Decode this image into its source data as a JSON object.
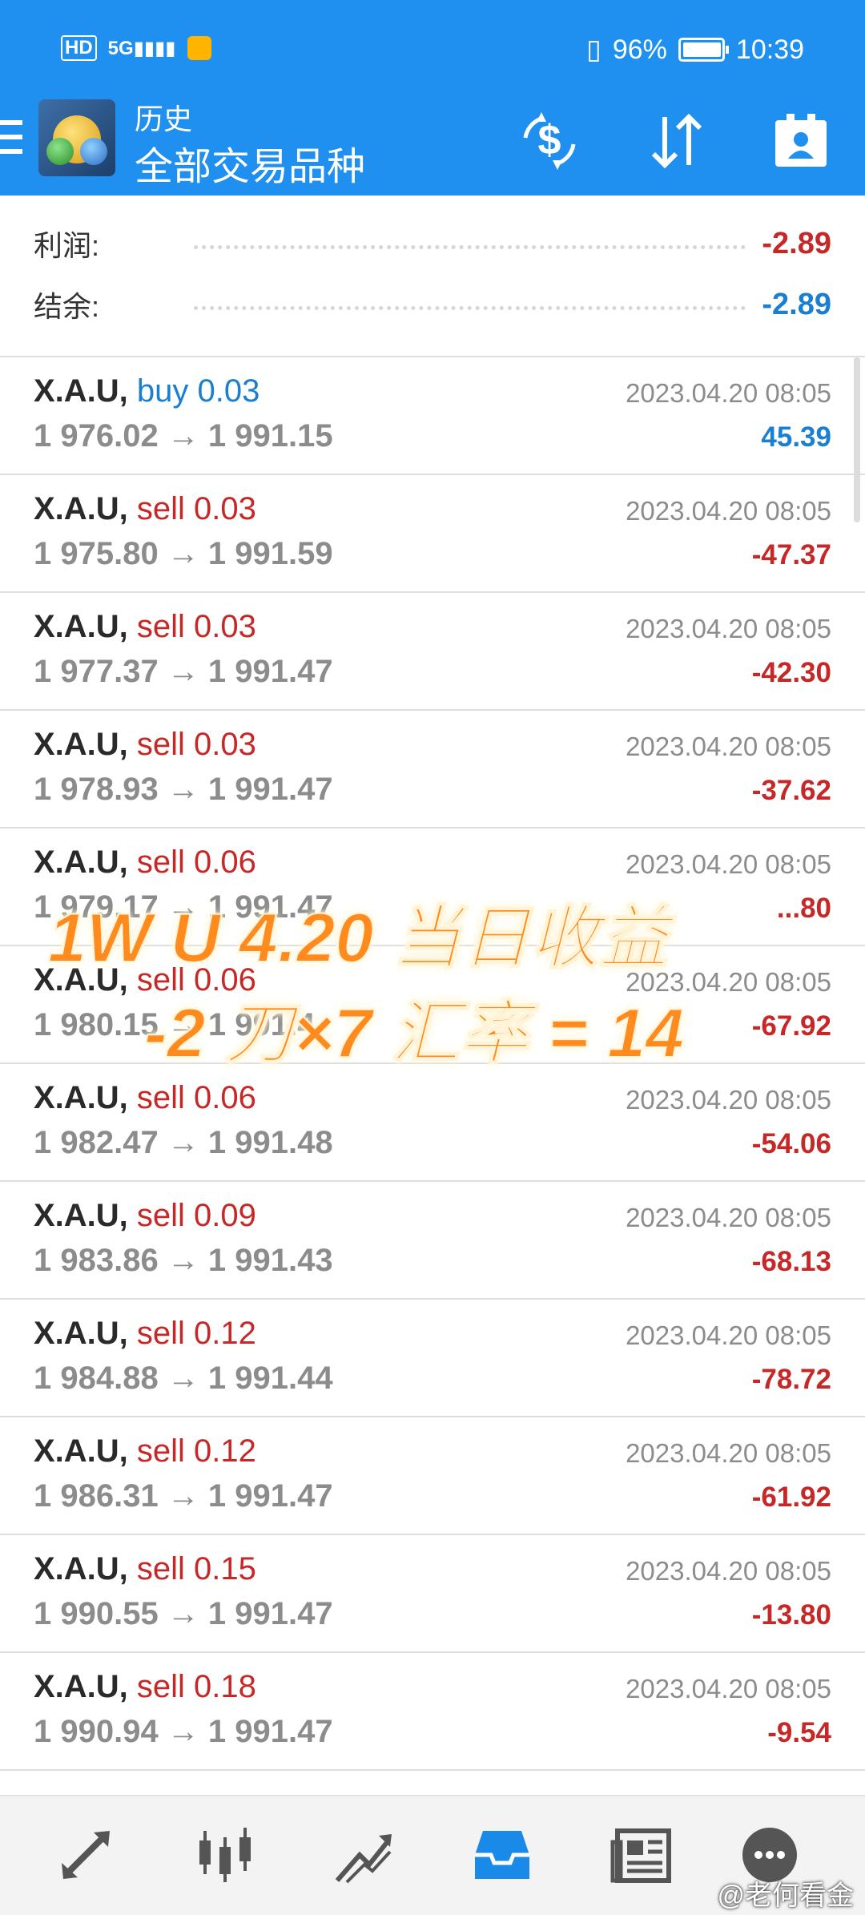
{
  "status_bar": {
    "network": "HD 5G",
    "battery_percent": "96%",
    "time": "10:39",
    "icons": [
      "hd-icon",
      "signal-icon",
      "weibo-icon",
      "vibrate-icon",
      "battery-icon"
    ]
  },
  "header": {
    "subtitle": "历史",
    "title": "全部交易品种",
    "icons": [
      "menu-icon",
      "app-logo-icon",
      "currency-exchange-icon",
      "sort-icon",
      "account-icon"
    ]
  },
  "summary": {
    "profit_label": "利润:",
    "profit_value": "-2.89",
    "balance_label": "结余:",
    "balance_value": "-2.89"
  },
  "deals": [
    {
      "symbol": "X.A.U,",
      "type": "buy 0.03",
      "prices": "1 976.02 → 1 991.15",
      "time": "2023.04.20 08:05",
      "profit": "45.39"
    },
    {
      "symbol": "X.A.U,",
      "type": "sell 0.03",
      "prices": "1 975.80 → 1 991.59",
      "time": "2023.04.20 08:05",
      "profit": "-47.37"
    },
    {
      "symbol": "X.A.U,",
      "type": "sell 0.03",
      "prices": "1 977.37 → 1 991.47",
      "time": "2023.04.20 08:05",
      "profit": "-42.30"
    },
    {
      "symbol": "X.A.U,",
      "type": "sell 0.03",
      "prices": "1 978.93 → 1 991.47",
      "time": "2023.04.20 08:05",
      "profit": "-37.62"
    },
    {
      "symbol": "X.A.U,",
      "type": "sell 0.06",
      "prices": "1 979.17 → 1 991.47",
      "time": "2023.04.20 08:05",
      "profit": "...80"
    },
    {
      "symbol": "X.A.U,",
      "type": "sell 0.06",
      "prices": "1 980.15 → 1 991.4",
      "time": "2023.04.20 08:05",
      "profit": "-67.92"
    },
    {
      "symbol": "X.A.U,",
      "type": "sell 0.06",
      "prices": "1 982.47 → 1 991.48",
      "time": "2023.04.20 08:05",
      "profit": "-54.06"
    },
    {
      "symbol": "X.A.U,",
      "type": "sell 0.09",
      "prices": "1 983.86 → 1 991.43",
      "time": "2023.04.20 08:05",
      "profit": "-68.13"
    },
    {
      "symbol": "X.A.U,",
      "type": "sell 0.12",
      "prices": "1 984.88 → 1 991.44",
      "time": "2023.04.20 08:05",
      "profit": "-78.72"
    },
    {
      "symbol": "X.A.U,",
      "type": "sell 0.12",
      "prices": "1 986.31 → 1 991.47",
      "time": "2023.04.20 08:05",
      "profit": "-61.92"
    },
    {
      "symbol": "X.A.U,",
      "type": "sell 0.15",
      "prices": "1 990.55 → 1 991.47",
      "time": "2023.04.20 08:05",
      "profit": "-13.80"
    },
    {
      "symbol": "X.A.U,",
      "type": "sell 0.18",
      "prices": "1 990.94 → 1 991.47",
      "time": "2023.04.20 08:05",
      "profit": "-9.54"
    }
  ],
  "overlay": {
    "line1": "1W  U    4.20 当日收益",
    "line2": "-2 刀×7 汇率 = 14"
  },
  "bottom_nav": {
    "items": [
      "quotes-icon",
      "chart-icon",
      "trade-icon",
      "history-icon",
      "news-icon",
      "chat-icon"
    ],
    "active": "history-icon"
  },
  "watermark": "@老何看金",
  "colors": {
    "header_blue": "#1f8ff0",
    "buy_blue": "#1a7fd0",
    "sell_red": "#c62828",
    "positive_blue": "#1a7fd0",
    "negative_red": "#c62828"
  }
}
